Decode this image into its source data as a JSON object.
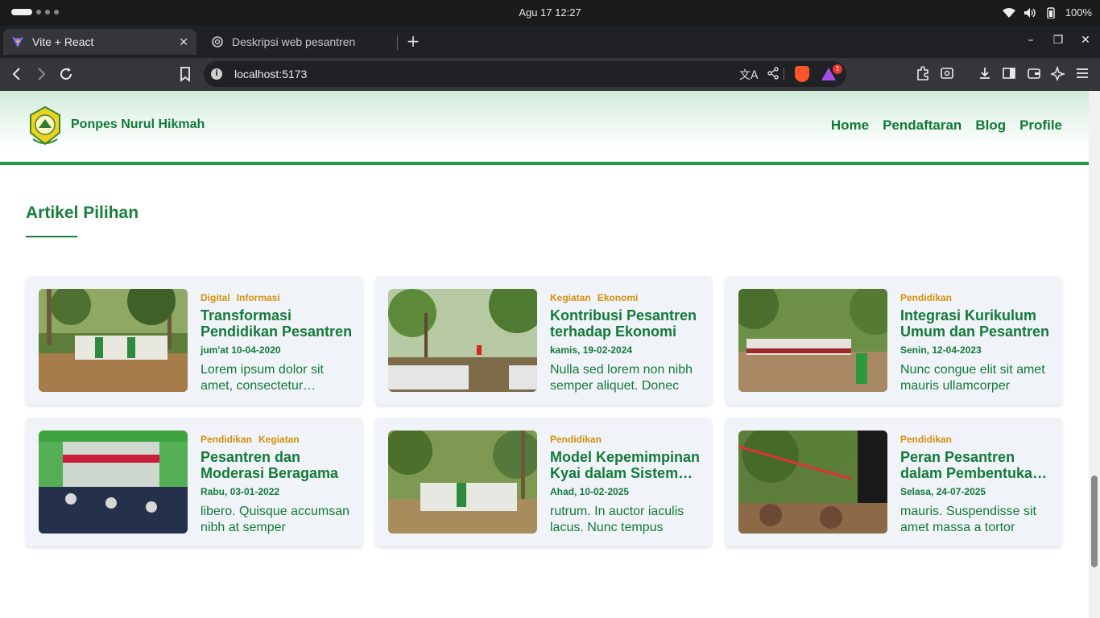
{
  "os": {
    "clock": "Agu 17  12:27",
    "battery": "100%"
  },
  "browser": {
    "tabs": [
      {
        "title": "Vite + React",
        "icon": "vite-icon",
        "active": true
      },
      {
        "title": "Deskripsi web pesantren",
        "icon": "openai-icon",
        "active": false
      }
    ],
    "url": "localhost:5173",
    "brave_badge": "1"
  },
  "site": {
    "brand": "Ponpes Nurul Hikmah",
    "nav": [
      "Home",
      "Pendaftaran",
      "Blog",
      "Profile"
    ],
    "section_title": "Artikel Pilihan",
    "accent": "#1e9d49",
    "category_color": "#d4910d",
    "articles": [
      {
        "categories": [
          "Digital",
          "Informasi"
        ],
        "title": "Transformasi Pendidikan Pesantren",
        "date": "jum'at 10-04-2020",
        "excerpt": "Lorem ipsum dolor sit amet, consectetur adipiscing elit"
      },
      {
        "categories": [
          "Kegiatan",
          "Ekonomi"
        ],
        "title": "Kontribusi Pesantren terhadap Ekonomi",
        "date": "kamis, 19-02-2024",
        "excerpt": "Nulla sed lorem non nibh semper aliquet. Donec"
      },
      {
        "categories": [
          "Pendidikan"
        ],
        "title": "Integrasi Kurikulum Umum dan Pesantren",
        "date": "Senin, 12-04-2023",
        "excerpt": "Nunc congue elit sit amet mauris ullamcorper"
      },
      {
        "categories": [
          "Pendidikan",
          "Kegiatan"
        ],
        "title": "Pesantren dan Moderasi Beragama",
        "date": "Rabu, 03-01-2022",
        "excerpt": "libero. Quisque accumsan nibh at semper"
      },
      {
        "categories": [
          "Pendidikan"
        ],
        "title": "Model Kepemimpinan Kyai dalam Sistem Pesantren",
        "date": "Ahad, 10-02-2025",
        "excerpt": "rutrum. In auctor iaculis lacus. Nunc tempus"
      },
      {
        "categories": [
          "Pendidikan"
        ],
        "title": "Peran Pesantren dalam Pembentukan Karakter",
        "date": "Selasa, 24-07-2025",
        "excerpt": "mauris. Suspendisse sit amet massa a tortor"
      }
    ]
  }
}
